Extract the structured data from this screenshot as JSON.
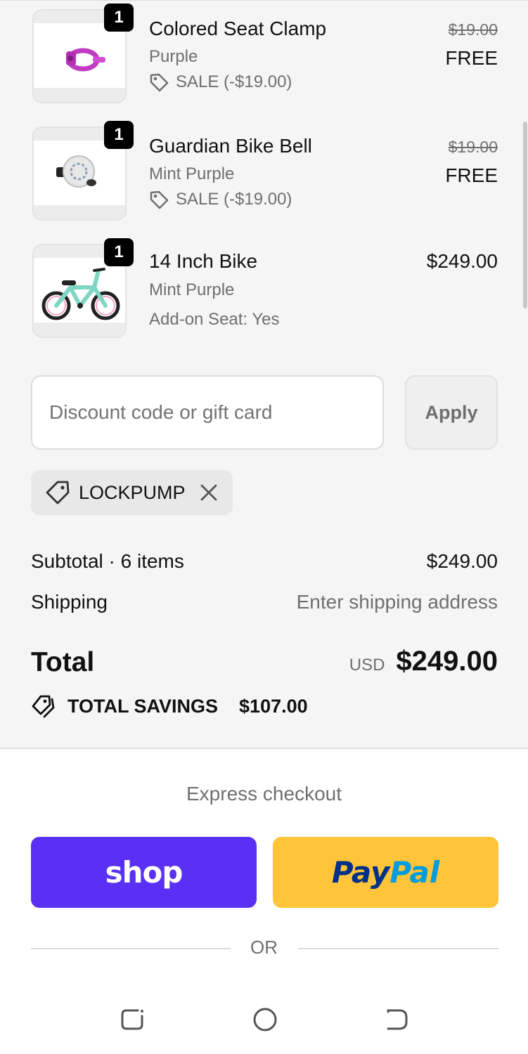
{
  "cart": {
    "items": [
      {
        "name": "Colored Seat Clamp",
        "variant": "Purple",
        "sale_label": "SALE (-$19.00)",
        "original_price": "$19.00",
        "price": "FREE",
        "quantity": "1"
      },
      {
        "name": "Guardian Bike Bell",
        "variant": "Mint Purple",
        "sale_label": "SALE (-$19.00)",
        "original_price": "$19.00",
        "price": "FREE",
        "quantity": "1"
      },
      {
        "name": "14 Inch Bike",
        "variant": "Mint Purple",
        "option": "Add-on Seat: Yes",
        "price": "$249.00",
        "quantity": "1"
      }
    ]
  },
  "discount": {
    "placeholder": "Discount code or gift card",
    "apply_label": "Apply",
    "applied_code": "LOCKPUMP"
  },
  "summary": {
    "subtotal_label": "Subtotal · 6 items",
    "subtotal_value": "$249.00",
    "shipping_label": "Shipping",
    "shipping_value": "Enter shipping address",
    "total_label": "Total",
    "currency": "USD",
    "total_value": "$249.00",
    "savings_label": "TOTAL SAVINGS",
    "savings_value": "$107.00"
  },
  "express": {
    "title": "Express checkout",
    "shop_label": "shop",
    "paypal_pay": "Pay",
    "paypal_pal": "Pal",
    "or_label": "OR"
  },
  "colors": {
    "shop": "#5a31f4",
    "paypal": "#ffc439",
    "summary_bg": "#f5f5f5"
  },
  "icons": [
    "tag-icon",
    "close-icon",
    "savings-tag-icon",
    "recent-apps-icon",
    "home-icon",
    "back-icon"
  ]
}
